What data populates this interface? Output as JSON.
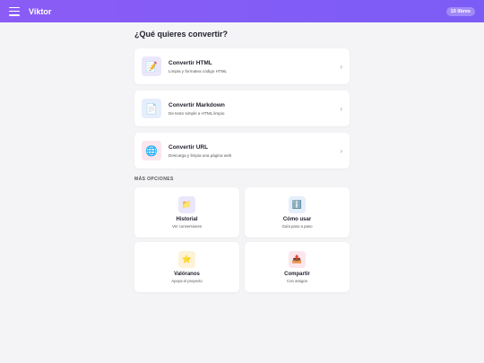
{
  "header": {
    "title": "Viktor",
    "badge": "10 libres"
  },
  "main": {
    "heading": "¿Qué quieres convertir?",
    "cards": [
      {
        "title": "Convertir HTML",
        "subtitle": "Limpia y formatea código HTML",
        "icon": "📝",
        "icon_name": "memo-icon",
        "icon_bg": "#ebe7fb"
      },
      {
        "title": "Convertir Markdown",
        "subtitle": "De texto simple a HTML limpio",
        "icon": "📄",
        "icon_name": "document-icon",
        "icon_bg": "#e5eefb"
      },
      {
        "title": "Convertir URL",
        "subtitle": "Descarga y limpia una página web",
        "icon": "🌐",
        "icon_name": "globe-icon",
        "icon_bg": "#fbe6ee"
      }
    ],
    "chevron": "›",
    "more_label": "MÁS OPCIONES",
    "options": [
      {
        "title": "Historial",
        "subtitle": "Ver conversiones",
        "icon": "📁",
        "icon_name": "folder-icon",
        "icon_bg": "#ebe7fb"
      },
      {
        "title": "Cómo usar",
        "subtitle": "Guía paso a paso",
        "icon": "ℹ️",
        "icon_name": "info-icon",
        "icon_bg": "#e5eefb"
      },
      {
        "title": "Valóranos",
        "subtitle": "Apoya el proyecto",
        "icon": "⭐",
        "icon_name": "star-icon",
        "icon_bg": "#fdf3d9"
      },
      {
        "title": "Compartir",
        "subtitle": "Con amigos",
        "icon": "📤",
        "icon_name": "share-icon",
        "icon_bg": "#fbe6ee"
      }
    ]
  }
}
